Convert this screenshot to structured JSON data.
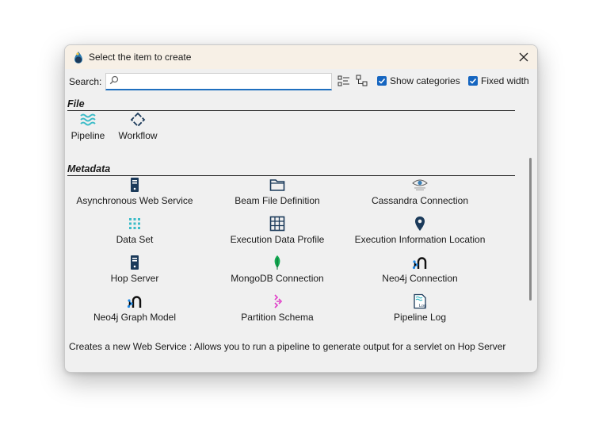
{
  "dialog": {
    "title": "Select the item to create",
    "search_label": "Search:",
    "search_value": "",
    "show_categories_label": "Show categories",
    "show_categories_checked": true,
    "fixed_width_label": "Fixed width",
    "fixed_width_checked": true,
    "accent_color": "#1565c0"
  },
  "categories": [
    {
      "name": "File",
      "items": [
        {
          "label": "Pipeline",
          "icon": "pipeline-icon"
        },
        {
          "label": "Workflow",
          "icon": "workflow-icon"
        }
      ]
    },
    {
      "name": "Metadata",
      "items": [
        {
          "label": "Asynchronous Web Service",
          "icon": "server-icon"
        },
        {
          "label": "Beam File Definition",
          "icon": "folder-icon"
        },
        {
          "label": "Cassandra Connection",
          "icon": "cassandra-eye-icon"
        },
        {
          "label": "Data Set",
          "icon": "dataset-grid-icon"
        },
        {
          "label": "Execution Data Profile",
          "icon": "table-grid-icon"
        },
        {
          "label": "Execution Information Location",
          "icon": "map-pin-icon"
        },
        {
          "label": "Hop Server",
          "icon": "server-icon"
        },
        {
          "label": "MongoDB Connection",
          "icon": "mongodb-leaf-icon"
        },
        {
          "label": "Neo4j Connection",
          "icon": "neo4j-icon"
        },
        {
          "label": "Neo4j Graph Model",
          "icon": "neo4j-icon"
        },
        {
          "label": "Partition Schema",
          "icon": "partition-arrows-icon"
        },
        {
          "label": "Pipeline Log",
          "icon": "pipeline-log-icon"
        }
      ]
    }
  ],
  "status_text": "Creates a new Web Service : Allows you to run a pipeline to generate output for a servlet on Hop Server"
}
